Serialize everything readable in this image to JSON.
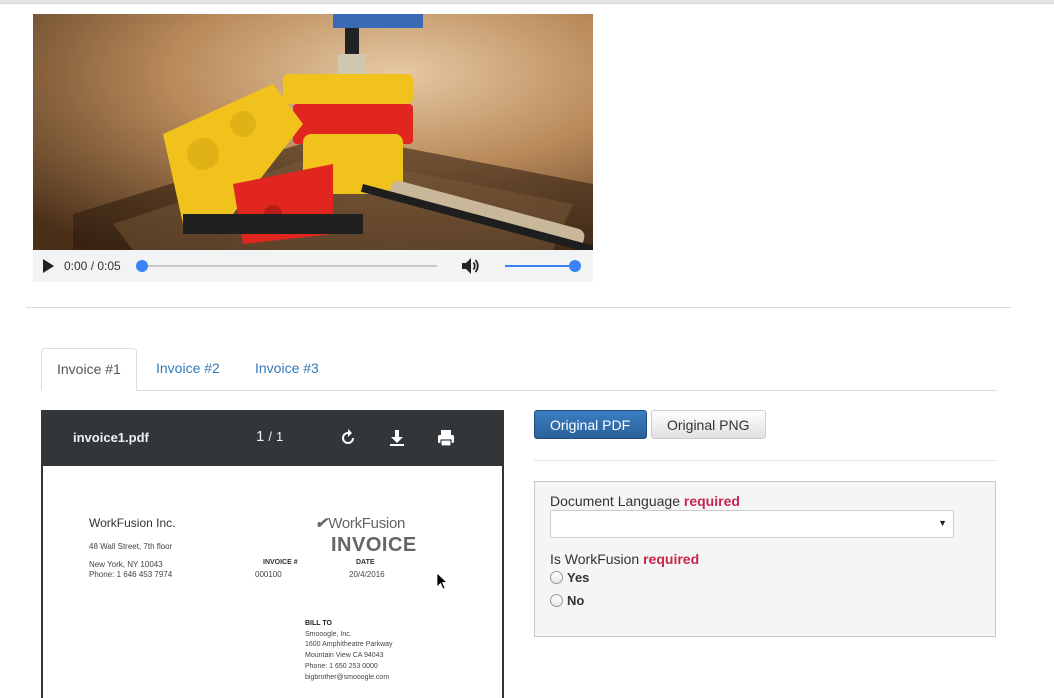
{
  "video": {
    "time": "0:00 / 0:05",
    "progress": 0,
    "volume": 1.0,
    "icons": {
      "play": "play-icon",
      "volume": "volume-icon"
    }
  },
  "tabs": [
    {
      "label": "Invoice #1",
      "active": true
    },
    {
      "label": "Invoice #2",
      "active": false
    },
    {
      "label": "Invoice #3",
      "active": false
    }
  ],
  "pdf_viewer": {
    "filename": "invoice1.pdf",
    "page_current": "1",
    "page_sep": "/",
    "page_total": "1",
    "icons": {
      "rotate": "rotate-icon",
      "download": "download-icon",
      "print": "print-icon"
    },
    "document": {
      "company": "WorkFusion Inc.",
      "address_line1": "48 Wall Street, 7th floor",
      "address_line2": "New York, NY 10043",
      "phone": "Phone: 1 646 453 7974",
      "logo_text": "WorkFusion",
      "title": "INVOICE",
      "invoice_label": "INVOICE #",
      "invoice_value": "000100",
      "date_label": "DATE",
      "date_value": "20/4/2016",
      "bill_to": {
        "label": "BILL TO",
        "lines": [
          "Smooogle, Inc.",
          "1600 Amphitheatre Parkway",
          "Mountain View CA 94043",
          "Phone: 1 650 253 0000",
          "bigbrother@smooogle.com"
        ]
      }
    }
  },
  "buttons": {
    "original_pdf": "Original PDF",
    "original_png": "Original PNG"
  },
  "form": {
    "language_label": "Document Language",
    "language_required": "required",
    "language_value": "",
    "workfusion_label": "Is WorkFusion",
    "workfusion_required": "required",
    "options": [
      "Yes",
      "No"
    ]
  },
  "colors": {
    "primary": "#2e6da4",
    "link": "#337ab7",
    "required": "#c7254e",
    "pdf_toolbar": "#323639",
    "media_accent": "#3b82f6"
  }
}
